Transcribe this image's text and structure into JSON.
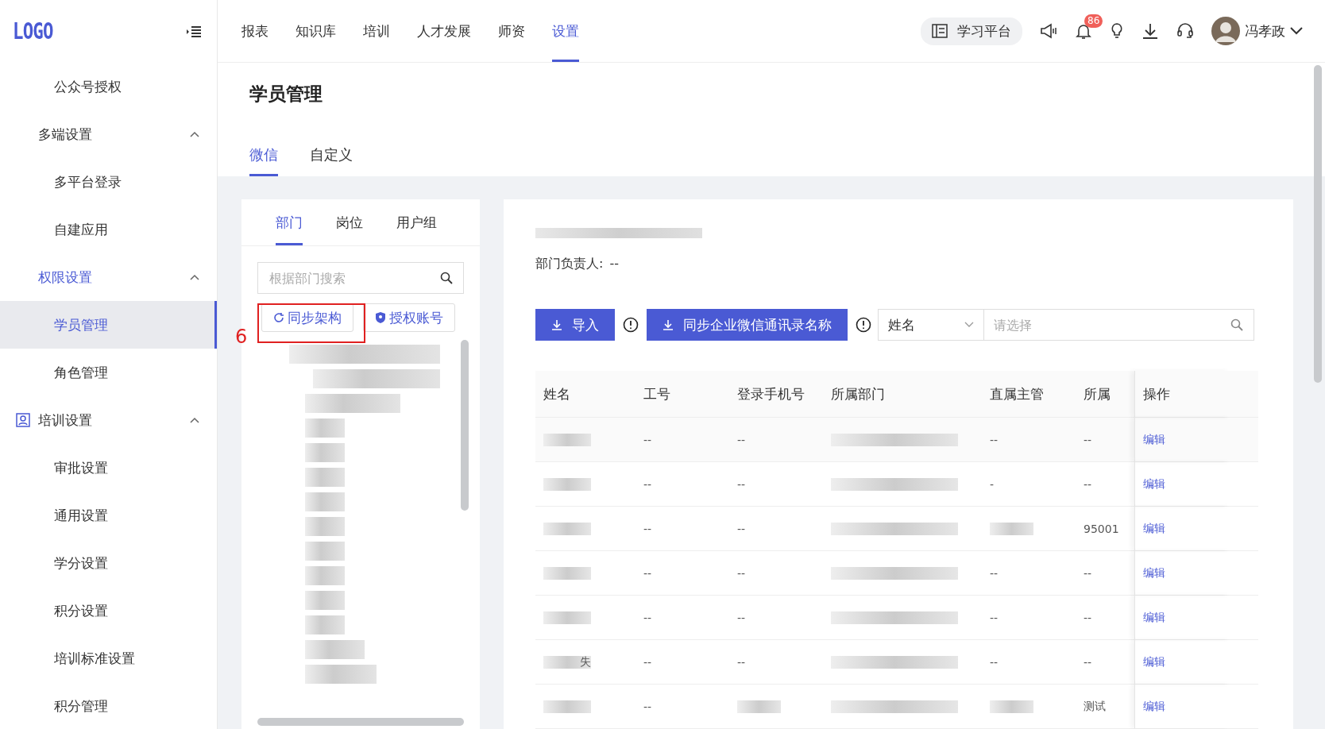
{
  "logo": "LOGO",
  "nav": [
    {
      "label": "报表",
      "selected": false
    },
    {
      "label": "知识库",
      "selected": false
    },
    {
      "label": "培训",
      "selected": false
    },
    {
      "label": "人才发展",
      "selected": false
    },
    {
      "label": "师资",
      "selected": false
    },
    {
      "label": "设置",
      "selected": true
    }
  ],
  "platform_button": "学习平台",
  "notifications": {
    "badge": "86"
  },
  "user": {
    "name": "冯孝政"
  },
  "sidebar": {
    "items": [
      {
        "label": "公众号授权",
        "selected": false
      },
      {
        "label": "多端设置",
        "expanded": true,
        "active": false,
        "icon": false,
        "children": [
          {
            "label": "多平台登录",
            "selected": false
          },
          {
            "label": "自建应用",
            "selected": false
          }
        ]
      },
      {
        "label": "权限设置",
        "expanded": true,
        "active": true,
        "icon": false,
        "children": [
          {
            "label": "学员管理",
            "selected": true
          },
          {
            "label": "角色管理",
            "selected": false
          }
        ]
      },
      {
        "label": "培训设置",
        "expanded": true,
        "active": false,
        "icon": true,
        "children": [
          {
            "label": "审批设置",
            "selected": false
          },
          {
            "label": "通用设置",
            "selected": false
          },
          {
            "label": "学分设置",
            "selected": false
          },
          {
            "label": "积分设置",
            "selected": false
          },
          {
            "label": "培训标准设置",
            "selected": false
          },
          {
            "label": "积分管理",
            "selected": false
          }
        ]
      }
    ]
  },
  "page_title": "学员管理",
  "tabs": [
    {
      "label": "微信",
      "selected": true
    },
    {
      "label": "自定义",
      "selected": false
    }
  ],
  "left_panel": {
    "tabs": [
      {
        "label": "部门",
        "selected": true
      },
      {
        "label": "岗位",
        "selected": false
      },
      {
        "label": "用户组",
        "selected": false
      }
    ],
    "search": {
      "placeholder": "根据部门搜索"
    },
    "buttons": [
      "同步架构",
      "授权账号"
    ],
    "annotation": {
      "label": "6"
    }
  },
  "detail": {
    "manager_label": "部门负责人:",
    "manager_value": "--"
  },
  "toolbar": {
    "import_button": "导入",
    "sync_button": "同步企业微信通讯录名称",
    "field_select": "姓名",
    "search": {
      "placeholder": "请选择"
    }
  },
  "table": {
    "columns": [
      "姓名",
      "工号",
      "登录手机号",
      "所属部门",
      "直属主管",
      "所属",
      "操作"
    ],
    "rows": [
      {
        "cells": [
          {
            "blurred": true
          },
          {
            "text": "--"
          },
          {
            "text": "--"
          },
          {
            "blurred": true
          },
          {
            "text": "--"
          },
          {
            "text": "--"
          }
        ],
        "action": "编辑"
      },
      {
        "cells": [
          {
            "blurred": true
          },
          {
            "text": "--"
          },
          {
            "text": "--"
          },
          {
            "blurred": true
          },
          {
            "text": "-"
          },
          {
            "text": "--"
          }
        ],
        "action": "编辑"
      },
      {
        "cells": [
          {
            "blurred": true
          },
          {
            "text": "--"
          },
          {
            "text": "--"
          },
          {
            "blurred": true
          },
          {
            "blurred": true
          },
          {
            "text": "95001"
          }
        ],
        "action": "编辑"
      },
      {
        "cells": [
          {
            "blurred": true
          },
          {
            "text": "--"
          },
          {
            "text": "--"
          },
          {
            "blurred": true
          },
          {
            "text": "--"
          },
          {
            "text": "--"
          }
        ],
        "action": "编辑"
      },
      {
        "cells": [
          {
            "blurred": true
          },
          {
            "text": "--"
          },
          {
            "text": "--"
          },
          {
            "blurred": true
          },
          {
            "text": "--"
          },
          {
            "text": "--"
          }
        ],
        "action": "编辑"
      },
      {
        "cells": [
          {
            "blurred": true,
            "text": "失"
          },
          {
            "text": "--"
          },
          {
            "text": "--"
          },
          {
            "blurred": true
          },
          {
            "text": "--"
          },
          {
            "text": "--"
          }
        ],
        "action": "编辑"
      },
      {
        "cells": [
          {
            "blurred": true
          },
          {
            "text": "--"
          },
          {
            "blurred": true
          },
          {
            "blurred": true
          },
          {
            "blurred": true
          },
          {
            "text": "测试"
          }
        ],
        "action": "编辑"
      }
    ]
  }
}
